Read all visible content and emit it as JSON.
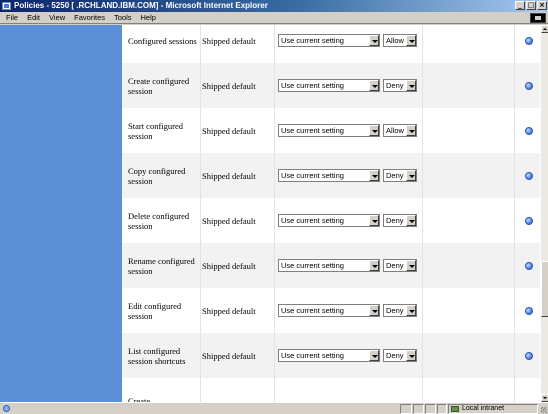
{
  "window": {
    "title": "Policies - 5250 [          .RCHLAND.IBM.COM] - Microsoft Internet Explorer",
    "controls": [
      "_",
      "□",
      "×"
    ]
  },
  "menu": {
    "items": [
      {
        "label": "File"
      },
      {
        "label": "Edit"
      },
      {
        "label": "View"
      },
      {
        "label": "Favorites"
      },
      {
        "label": "Tools"
      },
      {
        "label": "Help"
      }
    ]
  },
  "policies": {
    "rows": [
      {
        "name": "Configured sessions",
        "status": "Shipped default",
        "setting": "Use current setting",
        "permission": "Allow"
      },
      {
        "name": "Create configured session",
        "status": "Shipped default",
        "setting": "Use current setting",
        "permission": "Deny"
      },
      {
        "name": "Start configured session",
        "status": "Shipped default",
        "setting": "Use current setting",
        "permission": "Allow"
      },
      {
        "name": "Copy configured session",
        "status": "Shipped default",
        "setting": "Use current setting",
        "permission": "Deny"
      },
      {
        "name": "Delete configured session",
        "status": "Shipped default",
        "setting": "Use current setting",
        "permission": "Deny"
      },
      {
        "name": "Rename configured session",
        "status": "Shipped default",
        "setting": "Use current setting",
        "permission": "Deny"
      },
      {
        "name": "Edit configured session",
        "status": "Shipped default",
        "setting": "Use current setting",
        "permission": "Deny"
      },
      {
        "name": "List configured session shortcuts",
        "status": "Shipped default",
        "setting": "Use current setting",
        "permission": "Deny"
      },
      {
        "name": "Create",
        "status": "",
        "setting": "",
        "permission": ""
      }
    ]
  },
  "statusbar": {
    "zone": "Local intranet"
  },
  "colors": {
    "left_panel": "#5b8fd6",
    "row_alt": "#f2f2f2",
    "info_icon": "#3f72d8"
  }
}
